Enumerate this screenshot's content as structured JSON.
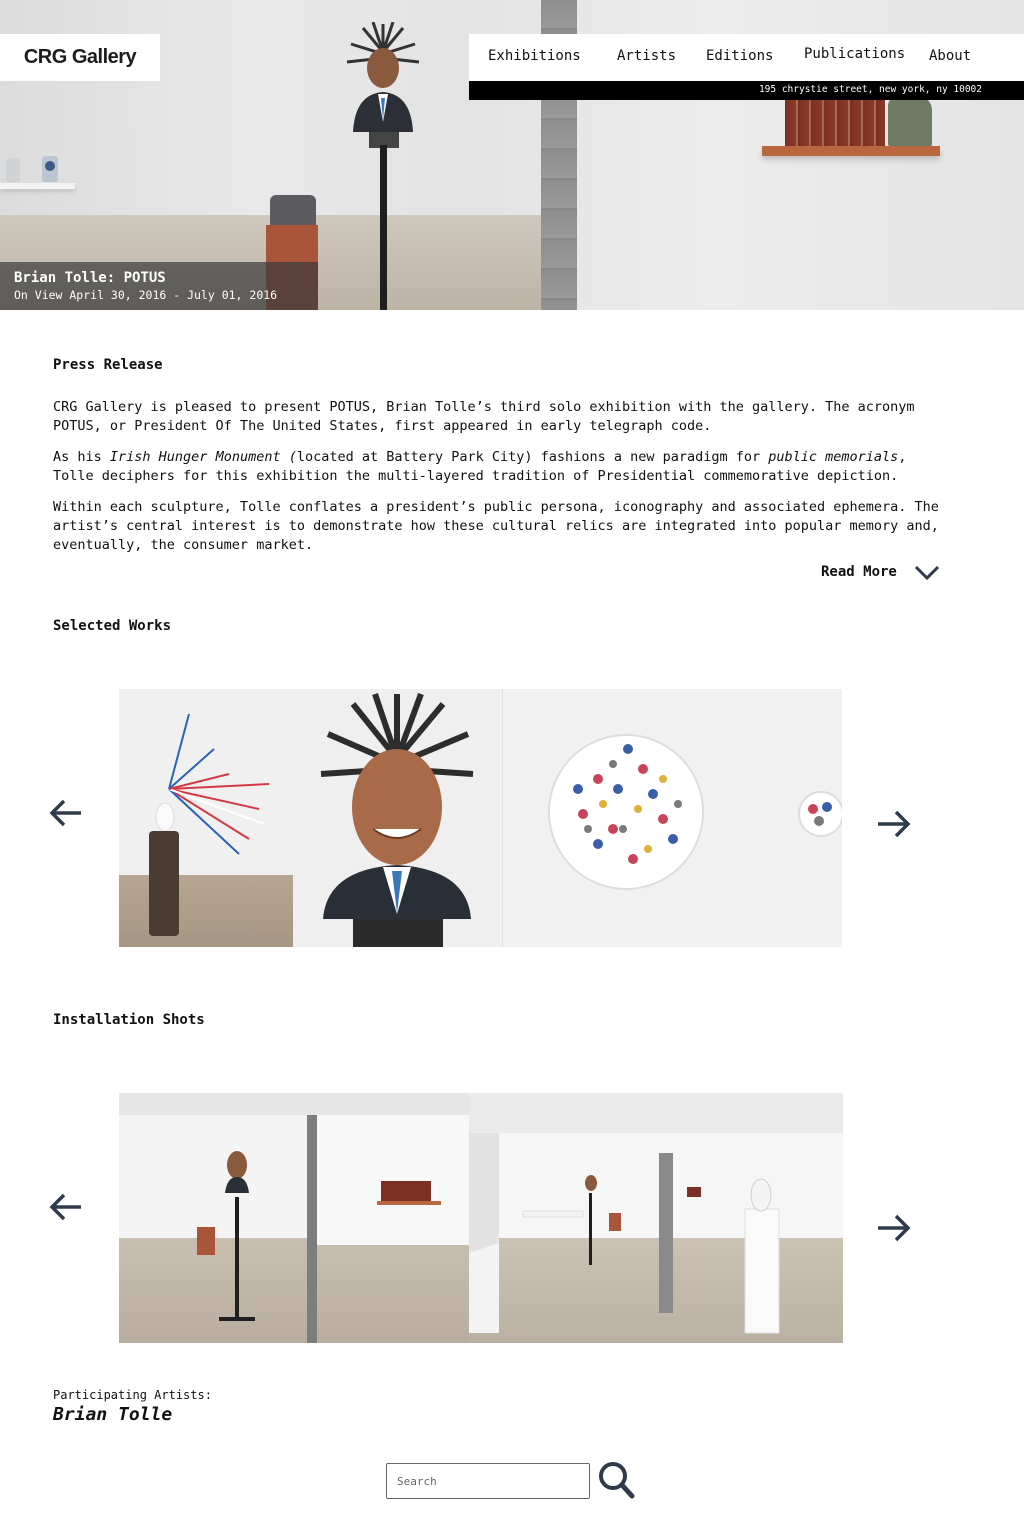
{
  "brand": {
    "logo_text": "CRG Gallery"
  },
  "nav": {
    "items": [
      {
        "label": "Exhibitions"
      },
      {
        "label": "Artists"
      },
      {
        "label": "Editions"
      },
      {
        "label": "Publications"
      },
      {
        "label": "About"
      }
    ],
    "address": "195 chrystie street, new york, ny 10002"
  },
  "hero": {
    "title": "Brian Tolle: POTUS",
    "dates": "On View April 30, 2016 - July 01, 2016"
  },
  "press": {
    "heading": "Press Release",
    "p1": "CRG Gallery is pleased to present POTUS, Brian Tolle’s third solo exhibition with the gallery. The acronym POTUS, or President Of The United States, first appeared in early telegraph code.",
    "p2_a": "As his ",
    "p2_em1": "Irish Hunger Monument (",
    "p2_b": "located at Battery Park City) fashions a new paradigm for ",
    "p2_em2": "public memorials",
    "p2_c": ", Tolle deciphers for this exhibition the multi-layered tradition of Presidential commemorative depiction.",
    "p3": "Within each sculpture, Tolle conflates a president’s public persona, iconography and associated ephemera. The artist’s central interest is to demonstrate how these cultural relics are integrated into popular memory and, eventually, the consumer market.",
    "read_more": "Read More"
  },
  "works": {
    "heading": "Selected Works"
  },
  "installation": {
    "heading": "Installation Shots"
  },
  "participating": {
    "label": "Participating Artists:",
    "artist": "Brian Tolle"
  },
  "search": {
    "placeholder": "Search"
  },
  "colors": {
    "arrow": "#2f3a4a",
    "address_bar": "#000000",
    "caption_overlay": "#3c3c3c"
  }
}
